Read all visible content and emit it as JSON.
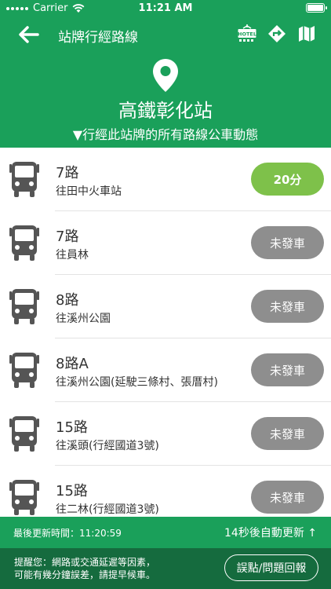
{
  "status_bar": {
    "carrier": "Carrier",
    "time": "11:21 AM"
  },
  "nav": {
    "title": "站牌行經路線",
    "hotel_label": "HOTEL"
  },
  "station": {
    "name": "高鐵彰化站",
    "subtitle": "▼行經此站牌的所有路線公車動態"
  },
  "routes": [
    {
      "name": "7路",
      "destination": "往田中火車站",
      "eta": "20分"
    },
    {
      "name": "7路",
      "destination": "往員林",
      "eta": "未發車"
    },
    {
      "name": "8路",
      "destination": "往溪州公園",
      "eta": "未發車"
    },
    {
      "name": "8路A",
      "destination": "往溪州公園(延駛三條村、張厝村)",
      "eta": "未發車"
    },
    {
      "name": "15路",
      "destination": "往溪頭(行經國道3號)",
      "eta": "未發車"
    },
    {
      "name": "15路",
      "destination": "往二林(行經國道3號)",
      "eta": "未發車"
    }
  ],
  "update_bar": {
    "last_update": "最後更新時間：11:20:59",
    "auto_refresh": "14秒後自動更新 ↑"
  },
  "notice": {
    "line1": "提醒您：網路或交通延遲等因素，",
    "line2": "可能有幾分鐘誤差，請提早候車。",
    "report_button": "誤點/問題回報"
  },
  "colors": {
    "primary_green": "#1aa05a",
    "active_eta": "#7ec14a",
    "inactive_eta": "#8e8e8e",
    "notice_bg": "#156b3e"
  }
}
